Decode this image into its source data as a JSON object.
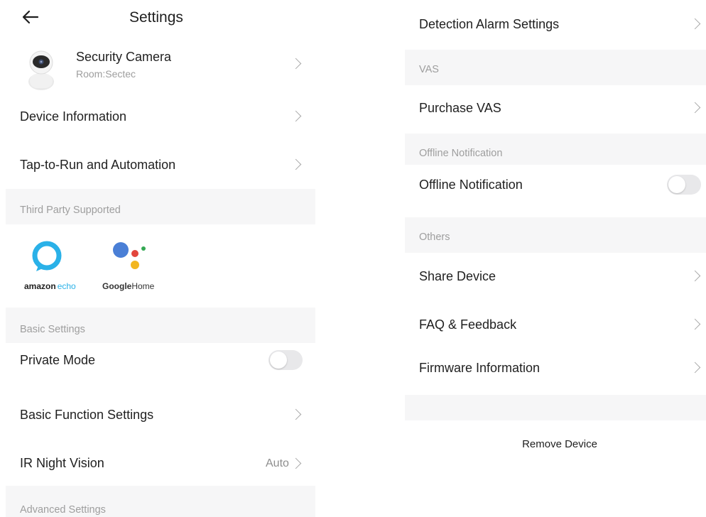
{
  "header": {
    "title": "Settings",
    "back_icon": "arrow-left-icon"
  },
  "device": {
    "name": "Security Camera",
    "room": "Room:Sectec"
  },
  "left_rows": {
    "device_information": "Device Information",
    "tap_to_run": "Tap-to-Run and Automation"
  },
  "third_party": {
    "section_label": "Third Party Supported",
    "alexa": {
      "label_bold": "amazon",
      "label_light": "echo"
    },
    "google": {
      "label_bold": "Google",
      "label_light": "Home"
    }
  },
  "basic_settings": {
    "section_label": "Basic Settings",
    "private_mode": "Private Mode",
    "private_mode_on": false,
    "basic_function": "Basic Function Settings",
    "ir_night_vision": "IR Night Vision",
    "ir_night_vision_value": "Auto"
  },
  "advanced_settings": {
    "section_label": "Advanced Settings"
  },
  "right_rows": {
    "detection_alarm": "Detection Alarm Settings"
  },
  "vas": {
    "section_label": "VAS",
    "purchase": "Purchase VAS"
  },
  "offline": {
    "section_label": "Offline Notification",
    "row": "Offline Notification",
    "enabled": false
  },
  "others": {
    "section_label": "Others",
    "share": "Share Device",
    "faq": "FAQ & Feedback",
    "firmware": "Firmware Information"
  },
  "remove_device": "Remove Device",
  "colors": {
    "section_bg": "#f6f6f7",
    "alexa_blue": "#2ab1e8",
    "google_blue": "#4a7fd6",
    "google_red": "#e2453c",
    "google_yellow": "#f2b620",
    "google_green": "#34a853"
  }
}
